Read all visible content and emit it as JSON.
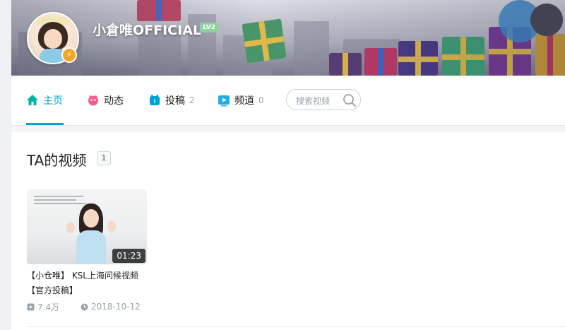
{
  "profile": {
    "username": "小倉唯OFFICIAL",
    "level": "LV2"
  },
  "nav": {
    "tabs": [
      {
        "label": "主页",
        "count": ""
      },
      {
        "label": "动态",
        "count": ""
      },
      {
        "label": "投稿",
        "count": "2"
      },
      {
        "label": "频道",
        "count": "0"
      }
    ],
    "active_tab": "主页"
  },
  "search": {
    "placeholder": "搜索视频",
    "value": ""
  },
  "section": {
    "title": "TA的视频",
    "count": "1"
  },
  "videos": [
    {
      "title": "【小仓唯】 KSL上海问候视频【官方投稿】",
      "duration": "01:23",
      "views": "7.4万",
      "date": "2018-10-12"
    }
  ],
  "colors": {
    "accent": "#00a1d6",
    "level_badge": "#8bd29b",
    "verify_badge": "#f5a623"
  },
  "icons": {
    "home": "home-icon",
    "dynamic": "dynamic-icon",
    "upload": "upload-icon",
    "channel": "channel-icon",
    "search": "search-icon",
    "play": "play-icon",
    "clock": "clock-icon",
    "verify": "lightning-icon"
  }
}
